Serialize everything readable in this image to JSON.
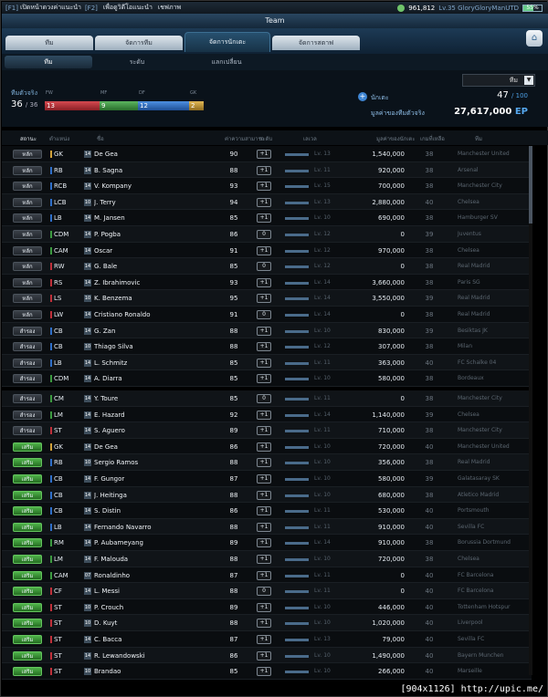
{
  "topbar": {
    "tag": "[F1]",
    "text1": "เปิดหน้าดวงค่าแนะนำ",
    "tag2": "[F2]",
    "text2": "เพื่อดูวิดีโอแนะนำ",
    "text3": "เชฟภาพ",
    "coins": "961,812",
    "level": "Lv.35 GloryGloryManUTD",
    "battery": "55%"
  },
  "title": "Team",
  "tabs": [
    "ทีม",
    "จัดการทีม",
    "จัดการนักเตะ",
    "จัดการสตาฟ"
  ],
  "subtabs": [
    "ทีม",
    "ระดับ",
    "แลกเปลี่ยน"
  ],
  "info": {
    "dropdown": "ทีม",
    "squad_label": "ทีมตัวจริง",
    "squad_count": "36",
    "squad_total": "/ 36",
    "positions": [
      {
        "label": "FW",
        "count": "13",
        "color": "#c0303a"
      },
      {
        "label": "MF",
        "count": "9",
        "color": "#3c9a40"
      },
      {
        "label": "DF",
        "count": "12",
        "color": "#2f6fc9"
      },
      {
        "label": "GK",
        "count": "2",
        "color": "#d2a23a"
      }
    ],
    "players_label": "นักเตะ",
    "players_count": "47",
    "players_max": "/ 100",
    "value_label": "มูลค่าของทีมตัวจริง",
    "value": "27,617,000",
    "value_unit": "EP"
  },
  "headers": {
    "status": "สถานะ",
    "position": "ตำแหน่ง",
    "name": "ชื่อ",
    "ovr": "ค่าความสามารถ",
    "level": "ระดับ",
    "exp": "เลเวล",
    "price": "มูลค่าของนักเตะ",
    "salary": "เกมที่เหลือ",
    "team": "ทีม"
  },
  "players": [
    {
      "status": "หลัก",
      "pos": "GK",
      "card": "14",
      "name": "De Gea",
      "ovr": "90",
      "lvl": "+1",
      "exp": "Lv. 13",
      "price": "1,540,000",
      "sal": "38",
      "team": "Manchester United",
      "posc": "#d2a23a"
    },
    {
      "status": "หลัก",
      "pos": "RB",
      "card": "14",
      "name": "B. Sagna",
      "ovr": "88",
      "lvl": "+1",
      "exp": "Lv. 11",
      "price": "920,000",
      "sal": "38",
      "team": "Arsenal",
      "posc": "#2f6fc9"
    },
    {
      "status": "หลัก",
      "pos": "RCB",
      "card": "14",
      "name": "V. Kompany",
      "ovr": "93",
      "lvl": "+1",
      "exp": "Lv. 15",
      "price": "700,000",
      "sal": "38",
      "team": "Manchester City",
      "posc": "#2f6fc9"
    },
    {
      "status": "หลัก",
      "pos": "LCB",
      "card": "10",
      "name": "J. Terry",
      "ovr": "94",
      "lvl": "+1",
      "exp": "Lv. 13",
      "price": "2,880,000",
      "sal": "40",
      "team": "Chelsea",
      "posc": "#2f6fc9"
    },
    {
      "status": "หลัก",
      "pos": "LB",
      "card": "14",
      "name": "M. Jansen",
      "ovr": "85",
      "lvl": "+1",
      "exp": "Lv. 10",
      "price": "690,000",
      "sal": "38",
      "team": "Hamburger SV",
      "posc": "#2f6fc9"
    },
    {
      "status": "หลัก",
      "pos": "CDM",
      "card": "14",
      "name": "P. Pogba",
      "ovr": "86",
      "lvl": "0",
      "exp": "Lv. 12",
      "price": "0",
      "sal": "39",
      "team": "Juventus",
      "posc": "#3c9a40"
    },
    {
      "status": "หลัก",
      "pos": "CAM",
      "card": "14",
      "name": "Oscar",
      "ovr": "91",
      "lvl": "+1",
      "exp": "Lv. 12",
      "price": "970,000",
      "sal": "38",
      "team": "Chelsea",
      "posc": "#3c9a40"
    },
    {
      "status": "หลัก",
      "pos": "RW",
      "card": "14",
      "name": "G. Bale",
      "ovr": "85",
      "lvl": "0",
      "exp": "Lv. 12",
      "price": "0",
      "sal": "38",
      "team": "Real Madrid",
      "posc": "#c0303a"
    },
    {
      "status": "หลัก",
      "pos": "RS",
      "card": "14",
      "name": "Z. Ibrahimovic",
      "ovr": "93",
      "lvl": "+1",
      "exp": "Lv. 14",
      "price": "3,660,000",
      "sal": "38",
      "team": "Paris SG",
      "posc": "#c0303a"
    },
    {
      "status": "หลัก",
      "pos": "LS",
      "card": "10",
      "name": "K. Benzema",
      "ovr": "95",
      "lvl": "+1",
      "exp": "Lv. 14",
      "price": "3,550,000",
      "sal": "39",
      "team": "Real Madrid",
      "posc": "#c0303a"
    },
    {
      "status": "หลัก",
      "pos": "LW",
      "card": "14",
      "name": "Cristiano Ronaldo",
      "ovr": "91",
      "lvl": "0",
      "exp": "Lv. 14",
      "price": "0",
      "sal": "38",
      "team": "Real Madrid",
      "posc": "#c0303a"
    },
    {
      "status": "สำรอง",
      "pos": "CB",
      "card": "14",
      "name": "G. Zan",
      "ovr": "88",
      "lvl": "+1",
      "exp": "Lv. 10",
      "price": "830,000",
      "sal": "39",
      "team": "Besiktas JK",
      "posc": "#2f6fc9"
    },
    {
      "status": "สำรอง",
      "pos": "CB",
      "card": "10",
      "name": "Thiago Silva",
      "ovr": "88",
      "lvl": "+1",
      "exp": "Lv. 12",
      "price": "307,000",
      "sal": "38",
      "team": "Milan",
      "posc": "#2f6fc9"
    },
    {
      "status": "สำรอง",
      "pos": "LB",
      "card": "14",
      "name": "L. Schmitz",
      "ovr": "85",
      "lvl": "+1",
      "exp": "Lv. 11",
      "price": "363,000",
      "sal": "40",
      "team": "FC Schalke 04",
      "posc": "#2f6fc9"
    },
    {
      "status": "สำรอง",
      "pos": "CDM",
      "card": "14",
      "name": "A. Diarra",
      "ovr": "85",
      "lvl": "+1",
      "exp": "Lv. 10",
      "price": "580,000",
      "sal": "38",
      "team": "Bordeaux",
      "posc": "#3c9a40"
    },
    {
      "status": "สำรอง",
      "pos": "CM",
      "card": "14",
      "name": "Y. Toure",
      "ovr": "85",
      "lvl": "0",
      "exp": "Lv. 11",
      "price": "0",
      "sal": "38",
      "team": "Manchester City",
      "posc": "#3c9a40"
    },
    {
      "status": "สำรอง",
      "pos": "LM",
      "card": "14",
      "name": "E. Hazard",
      "ovr": "92",
      "lvl": "+1",
      "exp": "Lv. 14",
      "price": "1,140,000",
      "sal": "39",
      "team": "Chelsea",
      "posc": "#3c9a40"
    },
    {
      "status": "สำรอง",
      "pos": "ST",
      "card": "14",
      "name": "S. Aguero",
      "ovr": "89",
      "lvl": "+1",
      "exp": "Lv. 11",
      "price": "710,000",
      "sal": "38",
      "team": "Manchester City",
      "posc": "#c0303a"
    },
    {
      "status": "เสริม",
      "pos": "GK",
      "card": "14",
      "name": "De Gea",
      "ovr": "86",
      "lvl": "+1",
      "exp": "Lv. 10",
      "price": "720,000",
      "sal": "40",
      "team": "Manchester United",
      "posc": "#d2a23a"
    },
    {
      "status": "เสริม",
      "pos": "RB",
      "card": "10",
      "name": "Sergio Ramos",
      "ovr": "88",
      "lvl": "+1",
      "exp": "Lv. 10",
      "price": "356,000",
      "sal": "38",
      "team": "Real Madrid",
      "posc": "#2f6fc9"
    },
    {
      "status": "เสริม",
      "pos": "CB",
      "card": "14",
      "name": "F. Gungor",
      "ovr": "87",
      "lvl": "+1",
      "exp": "Lv. 10",
      "price": "580,000",
      "sal": "39",
      "team": "Galatasaray SK",
      "posc": "#2f6fc9"
    },
    {
      "status": "เสริม",
      "pos": "CB",
      "card": "14",
      "name": "J. Heitinga",
      "ovr": "88",
      "lvl": "+1",
      "exp": "Lv. 10",
      "price": "680,000",
      "sal": "38",
      "team": "Atletico Madrid",
      "posc": "#2f6fc9"
    },
    {
      "status": "เสริม",
      "pos": "CB",
      "card": "14",
      "name": "S. Distin",
      "ovr": "86",
      "lvl": "+1",
      "exp": "Lv. 11",
      "price": "530,000",
      "sal": "40",
      "team": "Portsmouth",
      "posc": "#2f6fc9"
    },
    {
      "status": "เสริม",
      "pos": "LB",
      "card": "14",
      "name": "Fernando Navarro",
      "ovr": "88",
      "lvl": "+1",
      "exp": "Lv. 11",
      "price": "910,000",
      "sal": "40",
      "team": "Sevilla FC",
      "posc": "#2f6fc9"
    },
    {
      "status": "เสริม",
      "pos": "RM",
      "card": "14",
      "name": "P. Aubameyang",
      "ovr": "89",
      "lvl": "+1",
      "exp": "Lv. 14",
      "price": "910,000",
      "sal": "38",
      "team": "Borussia Dortmund",
      "posc": "#3c9a40"
    },
    {
      "status": "เสริม",
      "pos": "LM",
      "card": "14",
      "name": "F. Malouda",
      "ovr": "88",
      "lvl": "+1",
      "exp": "Lv. 10",
      "price": "720,000",
      "sal": "38",
      "team": "Chelsea",
      "posc": "#3c9a40"
    },
    {
      "status": "เสริม",
      "pos": "CAM",
      "card": "07",
      "name": "Ronaldinho",
      "ovr": "87",
      "lvl": "+1",
      "exp": "Lv. 11",
      "price": "0",
      "sal": "40",
      "team": "FC Barcelona",
      "posc": "#3c9a40"
    },
    {
      "status": "เสริม",
      "pos": "CF",
      "card": "14",
      "name": "L. Messi",
      "ovr": "88",
      "lvl": "0",
      "exp": "Lv. 11",
      "price": "0",
      "sal": "40",
      "team": "FC Barcelona",
      "posc": "#c0303a"
    },
    {
      "status": "เสริม",
      "pos": "ST",
      "card": "10",
      "name": "P. Crouch",
      "ovr": "89",
      "lvl": "+1",
      "exp": "Lv. 10",
      "price": "446,000",
      "sal": "40",
      "team": "Tottenham Hotspur",
      "posc": "#c0303a"
    },
    {
      "status": "เสริม",
      "pos": "ST",
      "card": "10",
      "name": "D. Kuyt",
      "ovr": "88",
      "lvl": "+1",
      "exp": "Lv. 10",
      "price": "1,020,000",
      "sal": "40",
      "team": "Liverpool",
      "posc": "#c0303a"
    },
    {
      "status": "เสริม",
      "pos": "ST",
      "card": "14",
      "name": "C. Bacca",
      "ovr": "87",
      "lvl": "+1",
      "exp": "Lv. 13",
      "price": "79,000",
      "sal": "40",
      "team": "Sevilla FC",
      "posc": "#c0303a"
    },
    {
      "status": "เสริม",
      "pos": "ST",
      "card": "14",
      "name": "R. Lewandowski",
      "ovr": "86",
      "lvl": "+1",
      "exp": "Lv. 10",
      "price": "1,490,000",
      "sal": "40",
      "team": "Bayern Munchen",
      "posc": "#c0303a"
    },
    {
      "status": "เสริม",
      "pos": "ST",
      "card": "10",
      "name": "Brandao",
      "ovr": "85",
      "lvl": "+1",
      "exp": "Lv. 10",
      "price": "266,000",
      "sal": "40",
      "team": "Marseille",
      "posc": "#c0303a"
    }
  ],
  "footer": "[904x1126] http://upic.me/"
}
